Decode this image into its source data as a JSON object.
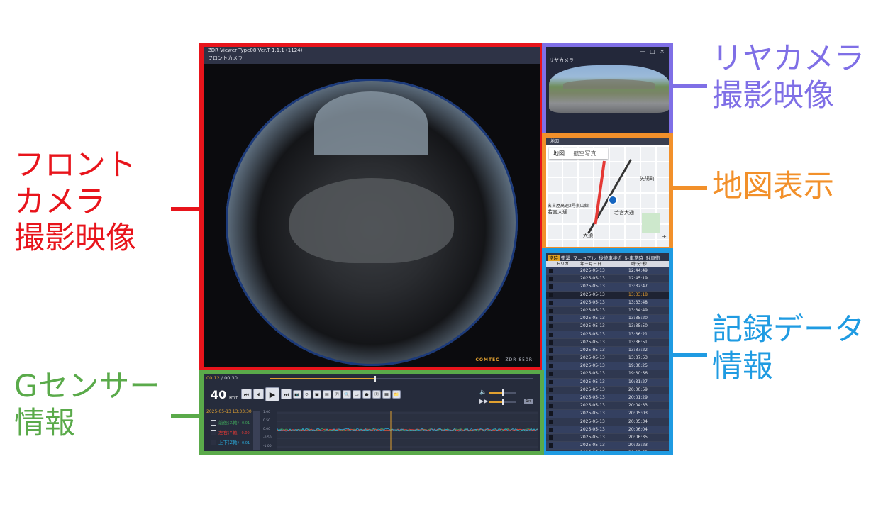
{
  "labels": {
    "front": [
      "フロント",
      "カメラ",
      "撮影映像"
    ],
    "rear": [
      "リヤカメラ",
      "撮影映像"
    ],
    "map": "地図表示",
    "records": [
      "記録データ",
      "情報"
    ],
    "gsensor": [
      "Gセンサー",
      "情報"
    ]
  },
  "app": {
    "title": "ZDR Viewer Type08 Ver.T 1.1.1 (1124)",
    "front_label": "フロントカメラ",
    "brand": "COMTEC",
    "model": "ZDR-850R"
  },
  "rear": {
    "title": "リヤカメラ",
    "window_controls": "— □ ×"
  },
  "map": {
    "header": "地図",
    "tabs": [
      "地図",
      "航空写真"
    ],
    "places": [
      "矢場町",
      "名古屋高速2号東山線",
      "若宮大通",
      "若宮大通",
      "大須"
    ],
    "zoom": "+"
  },
  "records": {
    "tabs": [
      "常時",
      "衝撃",
      "マニュアル",
      "後続車接近",
      "駐車常時",
      "駐車衝"
    ],
    "active_tab": 0,
    "columns": [
      "トリガ",
      "年－月－日",
      "時:分:秒"
    ],
    "selected_index": 3,
    "rows": [
      {
        "date": "2025-05-13",
        "time": "12:44:49"
      },
      {
        "date": "2025-05-13",
        "time": "12:45:19"
      },
      {
        "date": "2025-05-13",
        "time": "13:32:47"
      },
      {
        "date": "2025-05-13",
        "time": "13:33:18"
      },
      {
        "date": "2025-05-13",
        "time": "13:33:48"
      },
      {
        "date": "2025-05-13",
        "time": "13:34:49"
      },
      {
        "date": "2025-05-13",
        "time": "13:35:20"
      },
      {
        "date": "2025-05-13",
        "time": "13:35:50"
      },
      {
        "date": "2025-05-13",
        "time": "13:36:21"
      },
      {
        "date": "2025-05-13",
        "time": "13:36:51"
      },
      {
        "date": "2025-05-13",
        "time": "13:37:22"
      },
      {
        "date": "2025-05-13",
        "time": "13:37:53"
      },
      {
        "date": "2025-05-13",
        "time": "19:30:25"
      },
      {
        "date": "2025-05-13",
        "time": "19:30:56"
      },
      {
        "date": "2025-05-13",
        "time": "19:31:27"
      },
      {
        "date": "2025-05-13",
        "time": "20:00:59"
      },
      {
        "date": "2025-05-13",
        "time": "20:01:29"
      },
      {
        "date": "2025-05-13",
        "time": "20:04:33"
      },
      {
        "date": "2025-05-13",
        "time": "20:05:03"
      },
      {
        "date": "2025-05-13",
        "time": "20:05:34"
      },
      {
        "date": "2025-05-13",
        "time": "20:06:04"
      },
      {
        "date": "2025-05-13",
        "time": "20:06:35"
      },
      {
        "date": "2025-05-13",
        "time": "20:23:23"
      },
      {
        "date": "2025-05-13",
        "time": "20:23:53"
      },
      {
        "date": "2025-05-13",
        "time": "20:33:02"
      }
    ]
  },
  "player": {
    "current_time": "00:12",
    "separator": "/",
    "total_time": "00:30",
    "progress": 0.4,
    "speed_value": "40",
    "speed_unit": "km/h",
    "volume_level": 0.5,
    "rate_level": 0.5,
    "rate_label": "1×",
    "volume_icon": "🔈",
    "rate_icon": "▶▶",
    "buttons": [
      "⏮",
      "⏴",
      "▶",
      "⏭"
    ],
    "tool_buttons": [
      "📷",
      "⟳",
      "▣",
      "▤",
      "Ⓟ",
      "🔍",
      "▭",
      "●",
      "Ⓡ",
      "▦",
      "📁"
    ]
  },
  "gsensor": {
    "timestamp": "2025-05-13 13:33:30",
    "axes": [
      {
        "name": "前後(X軸)",
        "value": "0.01"
      },
      {
        "name": "左右(Y軸)",
        "value": "0.00"
      },
      {
        "name": "上下(Z軸)",
        "value": "0.01"
      }
    ],
    "y_ticks": [
      "1.00",
      "0.50",
      "0.00",
      "-0.50",
      "-1.00"
    ],
    "colors": {
      "x": "#3fa45b",
      "y": "#e53935",
      "z": "#2aa8d8"
    }
  }
}
